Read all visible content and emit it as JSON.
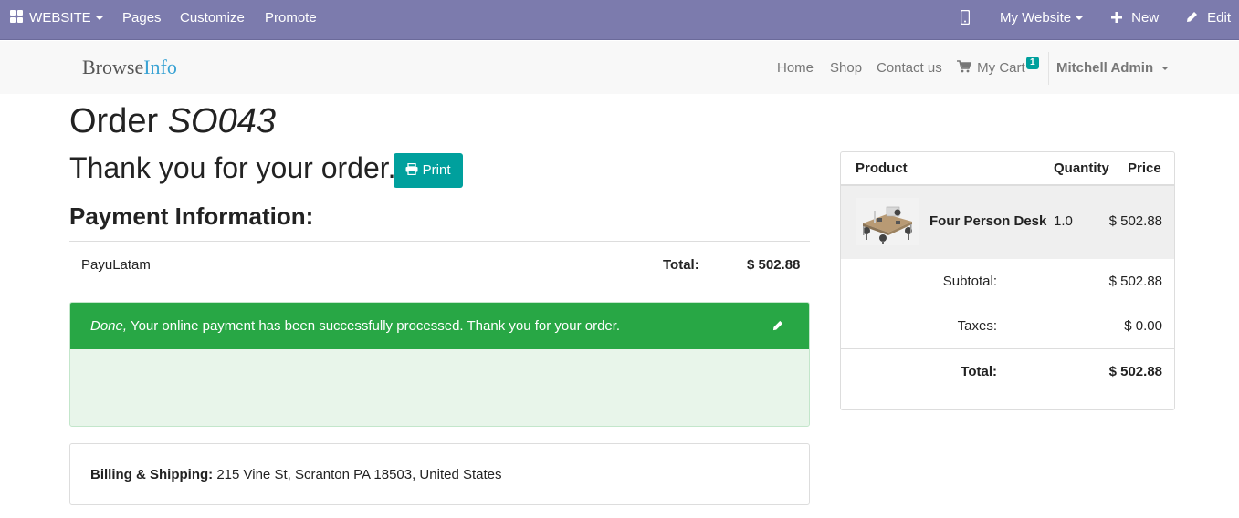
{
  "adminbar": {
    "website_label": "WEBSITE",
    "pages_label": "Pages",
    "customize_label": "Customize",
    "promote_label": "Promote",
    "site_selector_label": "My Website",
    "new_label": "New",
    "edit_label": "Edit",
    "bg_color": "#7c7bad"
  },
  "nav": {
    "brand_part1": "Browse",
    "brand_part2": "Info",
    "home": "Home",
    "shop": "Shop",
    "contact": "Contact us",
    "cart": "My Cart",
    "cart_count": "1",
    "user": "Mitchell Admin"
  },
  "order": {
    "title_prefix": "Order",
    "number": "SO043",
    "thanks": "Thank you for your order.",
    "print_label": "Print"
  },
  "payment": {
    "heading": "Payment Information:",
    "acquirer": "PayuLatam",
    "total_label": "Total:",
    "total_value": "$ 502.88"
  },
  "alert": {
    "status": "Done,",
    "message": "Your online payment has been successfully processed. Thank you for your order.",
    "color": "#28a745"
  },
  "billing": {
    "label": "Billing & Shipping:",
    "address": "215 Vine St, Scranton PA 18503, United States"
  },
  "summary": {
    "col_product": "Product",
    "col_quantity": "Quantity",
    "col_price": "Price",
    "items": [
      {
        "name": "Four Person Desk",
        "quantity": "1.0",
        "price": "$ 502.88"
      }
    ],
    "subtotal_label": "Subtotal:",
    "subtotal_value": "$ 502.88",
    "taxes_label": "Taxes:",
    "taxes_value": "$ 0.00",
    "total_label": "Total:",
    "total_value": "$ 502.88"
  },
  "accent_color": "#00a09d"
}
